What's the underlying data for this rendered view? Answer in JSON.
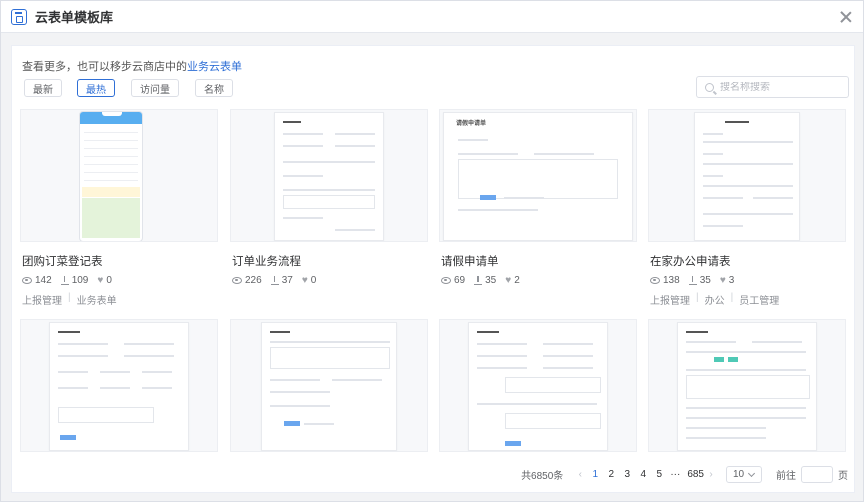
{
  "dialog": {
    "title": "云表单模板库"
  },
  "tip": {
    "text": "查看更多，也可以移步云商店中的",
    "link": "业务云表单"
  },
  "sorts": [
    {
      "label": "最新",
      "active": false
    },
    {
      "label": "最热",
      "active": true
    },
    {
      "label": "访问量",
      "active": false
    },
    {
      "label": "名称",
      "active": false
    }
  ],
  "search": {
    "placeholder": "搜名称搜索"
  },
  "cards": [
    {
      "name": "团购订菜登记表",
      "views": "142",
      "downloads": "109",
      "likes": "0",
      "tags": [
        "上报管理",
        "业务表单"
      ]
    },
    {
      "name": "订单业务流程",
      "views": "226",
      "downloads": "37",
      "likes": "0",
      "tags": []
    },
    {
      "name": "请假申请单",
      "views": "69",
      "downloads": "35",
      "likes": "2",
      "tags": []
    },
    {
      "name": "在家办公申请表",
      "views": "138",
      "downloads": "35",
      "likes": "3",
      "tags": [
        "上报管理",
        "办公",
        "员工管理"
      ]
    }
  ],
  "thumb_titles": [
    "请假申请单"
  ],
  "pager": {
    "total": "共6850条",
    "prev": "‹",
    "pages": [
      "1",
      "2",
      "3",
      "4",
      "5",
      "···",
      "685"
    ],
    "next": "›",
    "page_size": "10",
    "goto_label": "前往",
    "page_suffix": "页"
  },
  "colors": {
    "accent": "#2f6fd6"
  }
}
